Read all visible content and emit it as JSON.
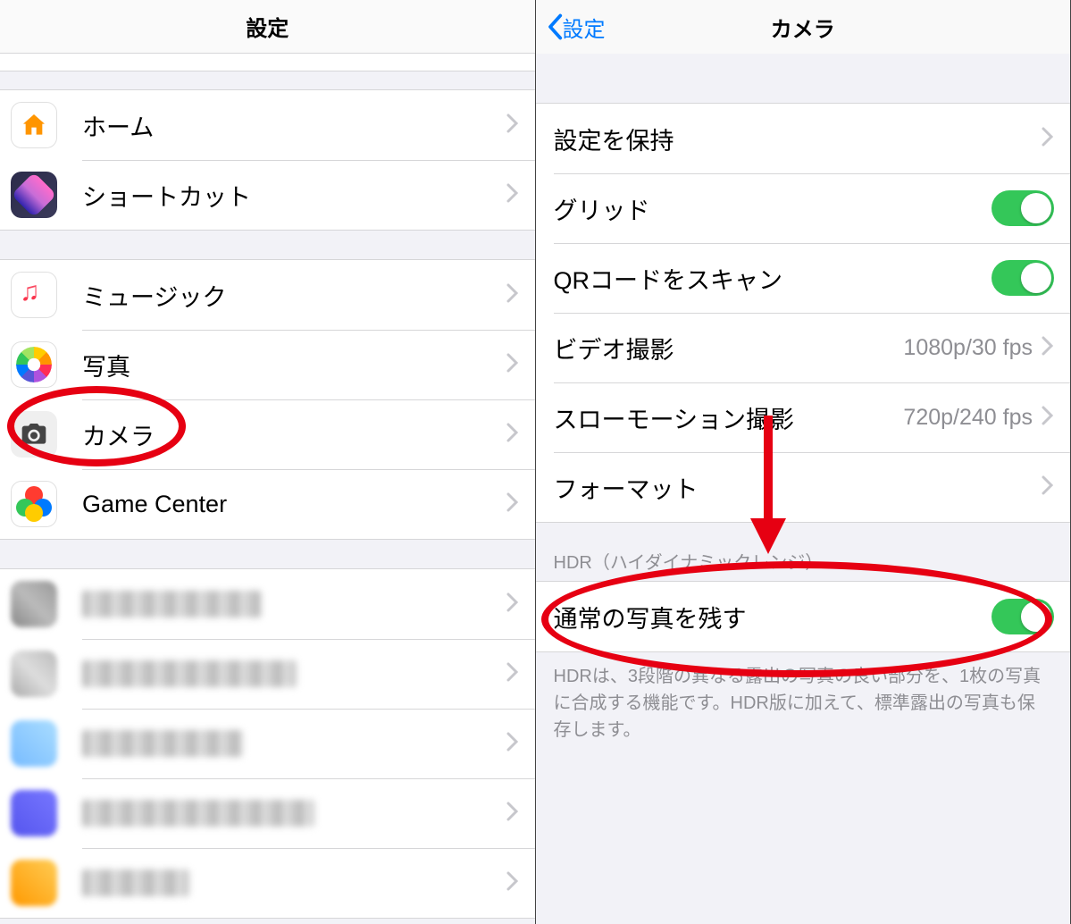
{
  "left": {
    "title": "設定",
    "group1": [
      {
        "label": "ホーム",
        "icon": "home"
      },
      {
        "label": "ショートカット",
        "icon": "shortcuts"
      }
    ],
    "group2": [
      {
        "label": "ミュージック",
        "icon": "music"
      },
      {
        "label": "写真",
        "icon": "photos"
      },
      {
        "label": "カメラ",
        "icon": "camera"
      },
      {
        "label": "Game Center",
        "icon": "gamecenter"
      }
    ]
  },
  "right": {
    "back": "設定",
    "title": "カメラ",
    "rows": {
      "preserve": "設定を保持",
      "grid": "グリッド",
      "qr": "QRコードをスキャン",
      "video": {
        "label": "ビデオ撮影",
        "value": "1080p/30 fps"
      },
      "slomo": {
        "label": "スローモーション撮影",
        "value": "720p/240 fps"
      },
      "format": "フォーマット"
    },
    "hdr_header": "HDR（ハイダイナミックレンジ）",
    "keep_normal": "通常の写真を残す",
    "hdr_footer": "HDRは、3段階の異なる露出の写真の良い部分を、1枚の写真に合成する機能です。HDR版に加えて、標準露出の写真も保存します。"
  },
  "annotations": {
    "highlight_camera": true,
    "highlight_keep_normal": true,
    "arrow": true
  }
}
